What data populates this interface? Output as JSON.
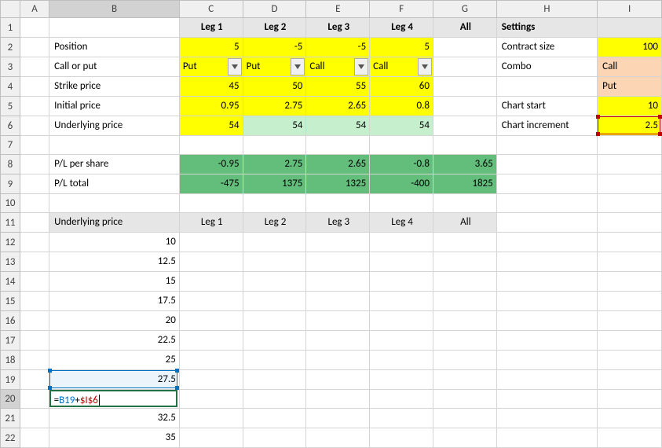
{
  "columns": [
    "A",
    "B",
    "C",
    "D",
    "E",
    "F",
    "G",
    "H",
    "I"
  ],
  "rows": [
    "1",
    "2",
    "3",
    "4",
    "5",
    "6",
    "7",
    "8",
    "9",
    "10",
    "11",
    "12",
    "13",
    "14",
    "15",
    "16",
    "17",
    "18",
    "19",
    "20",
    "21",
    "22"
  ],
  "header": {
    "leg1": "Leg 1",
    "leg2": "Leg 2",
    "leg3": "Leg 3",
    "leg4": "Leg 4",
    "all": "All",
    "settings": "Settings"
  },
  "labels": {
    "position": "Position",
    "callput": "Call or put",
    "strike": "Strike price",
    "initprice": "Initial price",
    "under": "Underlying price",
    "plshare": "P/L per share",
    "pltotal": "P/L total",
    "under2": "Underlying price"
  },
  "position": {
    "l1": "5",
    "l2": "-5",
    "l3": "-5",
    "l4": "5"
  },
  "callput": {
    "l1": "Put",
    "l2": "Put",
    "l3": "Call",
    "l4": "Call"
  },
  "strike": {
    "l1": "45",
    "l2": "50",
    "l3": "55",
    "l4": "60"
  },
  "init": {
    "l1": "0.95",
    "l2": "2.75",
    "l3": "2.65",
    "l4": "0.8"
  },
  "under": {
    "l1": "54",
    "l2": "54",
    "l3": "54",
    "l4": "54"
  },
  "plshare": {
    "l1": "-0.95",
    "l2": "2.75",
    "l3": "2.65",
    "l4": "-0.8",
    "all": "3.65"
  },
  "pltotal": {
    "l1": "-475",
    "l2": "1375",
    "l3": "1325",
    "l4": "-400",
    "all": "1825"
  },
  "settings": {
    "contractSize": "Contract size",
    "contractSizeVal": "100",
    "combo": "Combo",
    "comboCall": "Call",
    "comboPut": "Put",
    "chartStart": "Chart start",
    "chartStartVal": "10",
    "chartInc": "Chart increment",
    "chartIncVal": "2.5"
  },
  "legs11": {
    "l1": "Leg 1",
    "l2": "Leg 2",
    "l3": "Leg 3",
    "l4": "Leg 4",
    "all": "All"
  },
  "series": {
    "r12": "10",
    "r13": "12.5",
    "r14": "15",
    "r15": "17.5",
    "r16": "20",
    "r17": "22.5",
    "r18": "25",
    "r19": "27.5",
    "r21": "32.5",
    "r22": "35"
  },
  "formula": {
    "prefix": "=",
    "ref1": "B19",
    "op": "+",
    "ref2": "$I$6"
  }
}
